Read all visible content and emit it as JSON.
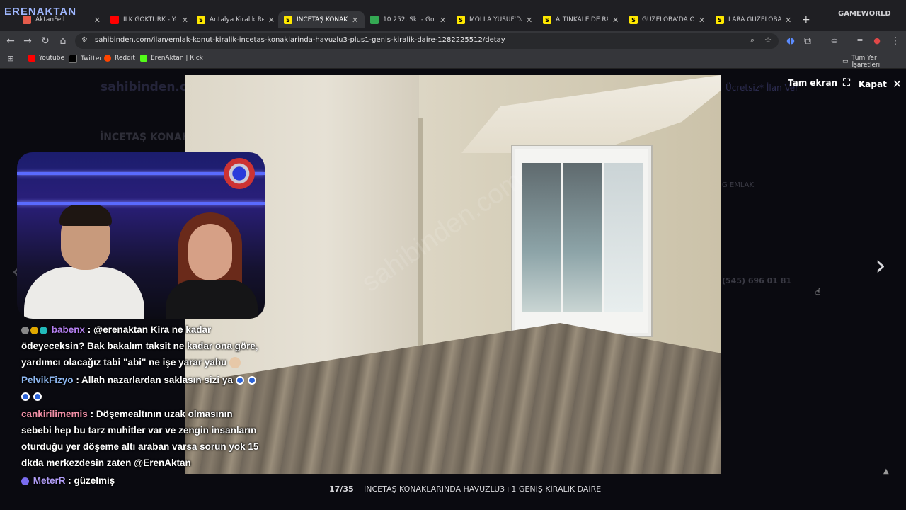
{
  "stream_logo": "ERENAKTAN",
  "game_logo": "GAMEWORLD",
  "tabs": [
    {
      "label": "AktanFell",
      "color": "#e45b4b",
      "active": false
    },
    {
      "label": "İLK GÖKTÜRK - YouTube",
      "color": "#ff0000",
      "active": false
    },
    {
      "label": "Antalya Kiralık Rezidans",
      "color": "#ffe800",
      "active": false
    },
    {
      "label": "İNCETAŞ KONAKLARINDA",
      "color": "#ffe800",
      "active": true
    },
    {
      "label": "10 252. Sk. - Google Maps",
      "color": "#34a853",
      "active": false
    },
    {
      "label": "MOLLA YUSUF'DA KİRALIK",
      "color": "#ffe800",
      "active": false
    },
    {
      "label": "ALTINKALE'DE RADA",
      "color": "#ffe800",
      "active": false
    },
    {
      "label": "GÜZELOBA'DA ORMAN",
      "color": "#ffe800",
      "active": false
    },
    {
      "label": "LARA GÜZELOBADA",
      "color": "#ffe800",
      "active": false
    }
  ],
  "new_tab": "+",
  "address": {
    "url": "sahibinden.com/ilan/emlak-konut-kiralik-incetas-konaklarinda-havuzlu3-plus1-genis-kiralik-daire-1282225512/detay"
  },
  "bookmarks": [
    {
      "label": "Youtube",
      "color": "#ff0000"
    },
    {
      "label": "Twitter",
      "color": "#000000"
    },
    {
      "label": "Reddit",
      "color": "#ff4500"
    },
    {
      "label": "ErenAktan | Kick",
      "color": "#53fc18"
    }
  ],
  "all_bookmarks": "Tüm Yer İşaretleri",
  "background_page": {
    "site_logo": "sahibinden.com",
    "title": "İNCETAŞ KONAK",
    "post_free": "Ücretsiz* İlan Ver",
    "office": "G EMLAK",
    "phone": "(545) 696 01 81"
  },
  "viewer": {
    "fullscreen": "Tam ekran",
    "close": "Kapat",
    "counter": "17/35",
    "title": "İNCETAŞ KONAKLARINDA HAVUZLU3+1 GENİŞ KİRALIK DAİRE",
    "watermark": "sahibinden.com"
  },
  "chat": [
    {
      "user": "babenx",
      "text": ": @erenaktan Kira ne kadar ödeyeceksin? Bak bakalım taksit ne kadar ona göre, yardımcı olacağız tabi \"abi\" ne işe yarar yahu"
    },
    {
      "user": "PelvikFizyo",
      "text": ": Allah nazarlardan saklasın sizi ya"
    },
    {
      "user": "cankirilimemis",
      "text": ": Döşemealtının uzak olmasının sebebi hep bu tarz muhitler var ve zengin insanların oturduğu yer döşeme altı araban varsa sorun yok 15 dkda merkezdesin zaten @ErenAktan"
    },
    {
      "user": "MeterR",
      "text": ": güzelmiş"
    }
  ]
}
